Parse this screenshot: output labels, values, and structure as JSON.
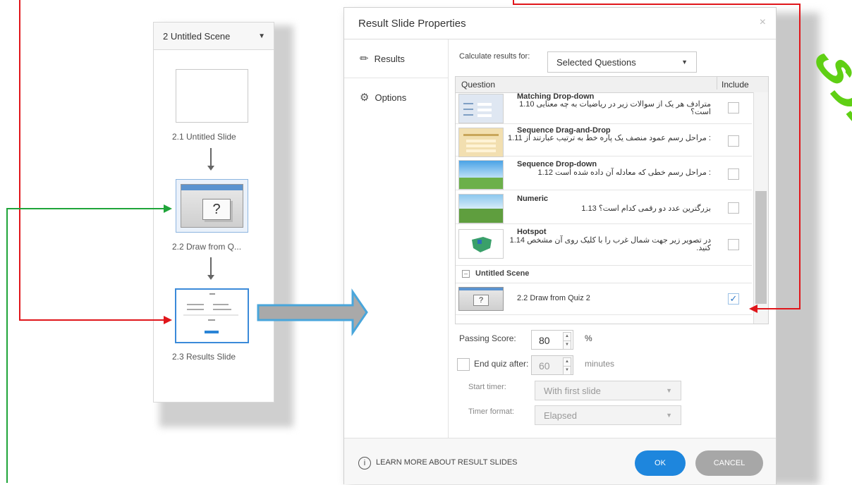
{
  "scene_panel": {
    "title": "2 Untitled Scene",
    "slides": [
      {
        "label": "2.1 Untitled Slide"
      },
      {
        "label": "2.2 Draw from Q..."
      },
      {
        "label": "2.3 Results Slide"
      }
    ],
    "quiz_placeholder": "?"
  },
  "dialog": {
    "title": "Result Slide Properties",
    "close_glyph": "×",
    "nav": [
      {
        "label": "Results",
        "icon": "pencil-icon"
      },
      {
        "label": "Options",
        "icon": "gear-icon"
      }
    ],
    "calculate_label": "Calculate results for:",
    "calculate_value": "Selected Questions",
    "table": {
      "col_question": "Question",
      "col_include": "Include",
      "rows": [
        {
          "type": "Matching Drop-down",
          "text": "مترادف هر یک از سوالات زیر در ریاضیات به چه معنایی 1.10 است؟",
          "included": false
        },
        {
          "type": "Sequence Drag-and-Drop",
          "text": ": مراحل رسم عمود منصف یک پاره خط به ترتیب عبارتند از 1.11",
          "included": false
        },
        {
          "type": "Sequence Drop-down",
          "text": ": مراحل رسم خطی که معادله آن داده شده است 1.12",
          "included": false
        },
        {
          "type": "Numeric",
          "text": "بزرگترین عدد دو رقمی کدام است؟ 1.13",
          "included": false
        },
        {
          "type": "Hotspot",
          "text": "در تصویر زیر جهت شمال غرب را با کلیک روی آن مشخص 1.14 کنید.",
          "included": false
        }
      ],
      "group_label": "Untitled Scene",
      "group_row": {
        "text": "2.2 Draw from Quiz 2",
        "included": true
      }
    },
    "passing_score_label": "Passing Score:",
    "passing_score_value": "80",
    "percent_unit": "%",
    "end_quiz_label": "End quiz after:",
    "end_quiz_value": "60",
    "minutes_unit": "minutes",
    "start_timer_label": "Start timer:",
    "start_timer_value": "With first slide",
    "timer_format_label": "Timer format:",
    "timer_format_value": "Elapsed",
    "learn_more": "LEARN MORE ABOUT RESULT SLIDES",
    "ok_label": "OK",
    "cancel_label": "CANCEL"
  },
  "watermark": "فناوری",
  "colors": {
    "accent": "#1e86dd",
    "arrow_red": "#e0161b",
    "arrow_green": "#1fa53a",
    "watermark": "#5fcf14"
  }
}
